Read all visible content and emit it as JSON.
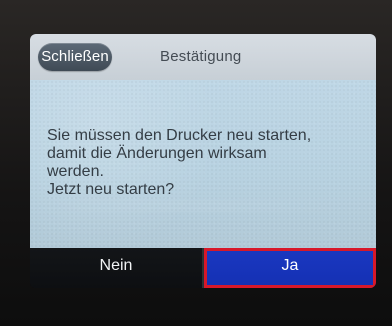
{
  "header": {
    "close_label": "Schließen",
    "title": "Bestätigung"
  },
  "dialog": {
    "message_lines": [
      "Sie müssen den Drucker neu starten,",
      "damit die Änderungen wirksam",
      "werden.",
      "Jetzt neu starten?"
    ]
  },
  "buttons": {
    "no_label": "Nein",
    "yes_label": "Ja"
  },
  "colors": {
    "header_background": "#d7dde3",
    "close_button": "#4d5a67",
    "content_background": "#bfd7e6",
    "footer_background": "#101215",
    "yes_button": "#1b38c1",
    "highlight_border": "#d7182a"
  }
}
